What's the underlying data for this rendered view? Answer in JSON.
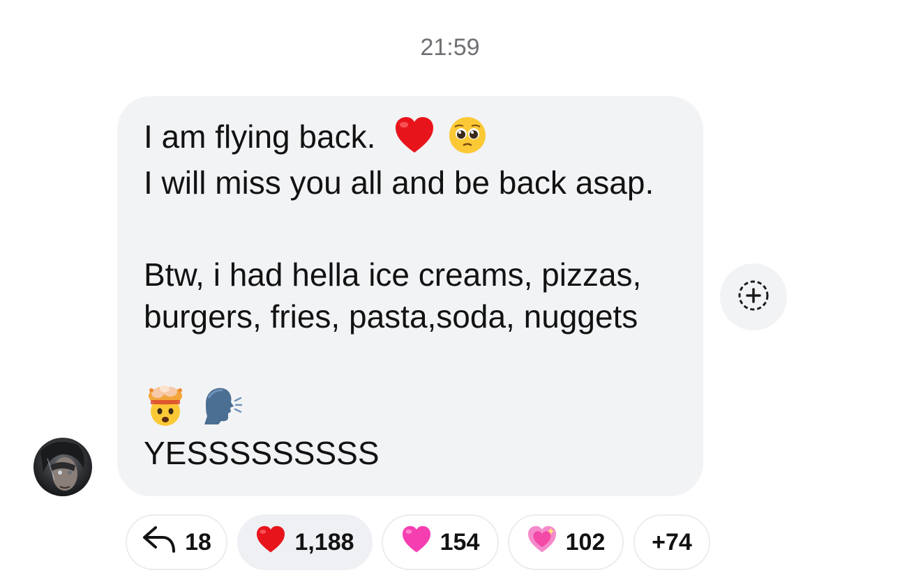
{
  "timestamp": "21:59",
  "message": {
    "lines": [
      "I am flying back.",
      "I will miss you all and be back asap.",
      "Btw, i had hella ice creams, pizzas,",
      "burgers, fries, pasta,soda, nuggets",
      "YESSSSSSSSS"
    ],
    "emojis": [
      "red-heart",
      "pleading-face",
      "exploding-head",
      "speaking-head"
    ],
    "bubble_color": "#f2f3f5"
  },
  "reactions": {
    "reply": {
      "icon": "reply-arrow-icon",
      "count": "18"
    },
    "items": [
      {
        "emoji": "red-heart",
        "count": "1,188",
        "selected": true
      },
      {
        "emoji": "pink-heart",
        "count": "154",
        "selected": false
      },
      {
        "emoji": "sparkling-heart",
        "count": "102",
        "selected": false
      }
    ],
    "more": "+74",
    "add_icon": "add-reaction-icon"
  },
  "colors": {
    "timestamp": "#6f6f74",
    "red_heart": "#e8141c",
    "pink_heart": "#f53fb1",
    "sparkling_heart": "#f58acb"
  }
}
